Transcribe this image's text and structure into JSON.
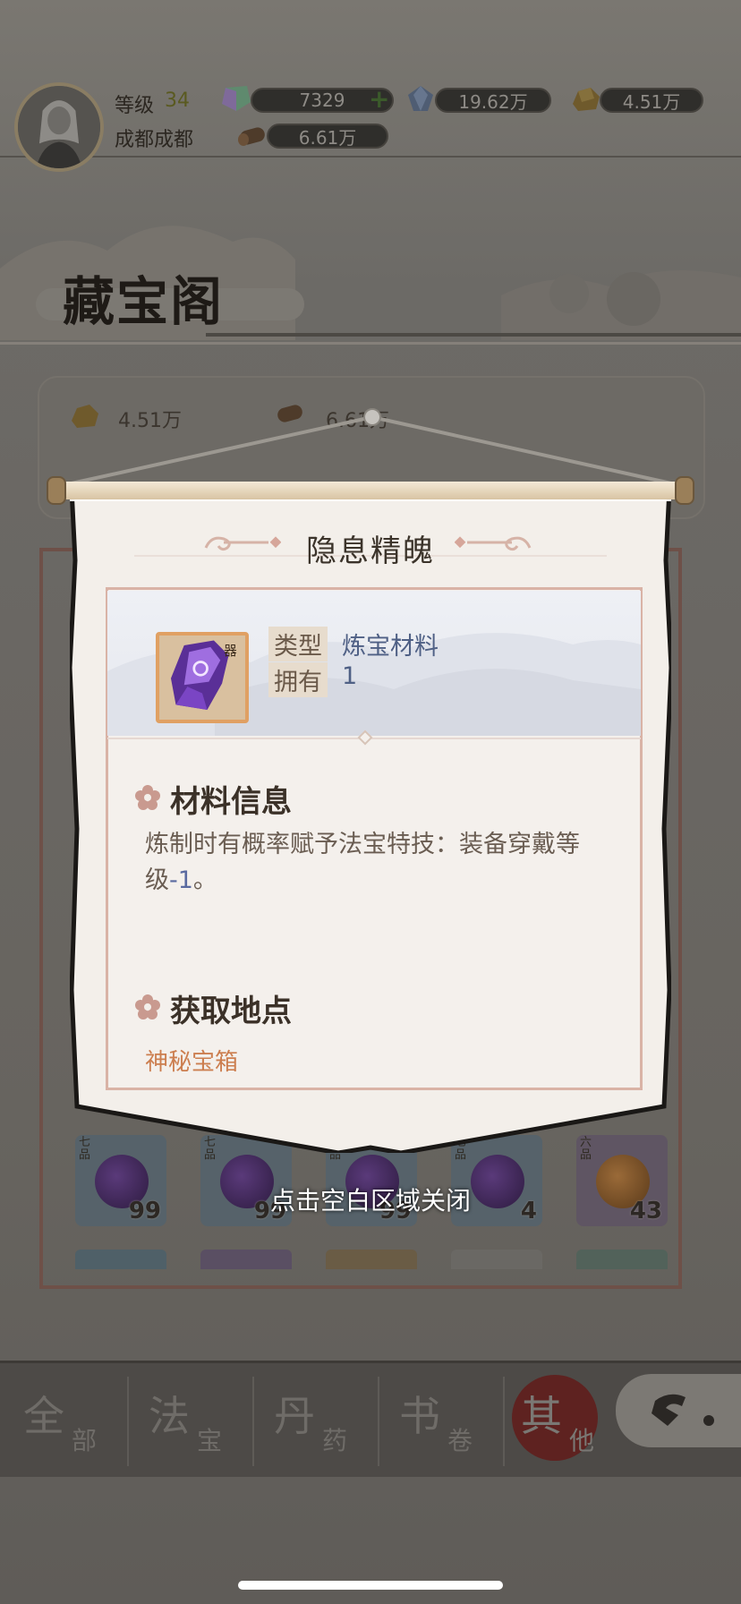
{
  "hud": {
    "level_label": "等级",
    "level_value": "34",
    "player_name": "成都成都",
    "jade_amount": "7329",
    "jade_add": "+",
    "crystal_amount": "19.62万",
    "gold_amount": "4.51万",
    "wood_amount": "6.61万"
  },
  "page": {
    "title": "藏宝阁",
    "panel_gold": "4.51万",
    "panel_wood": "6.61万"
  },
  "inventory_slots": [
    {
      "grade": "七品",
      "count": "99",
      "color": "#7f66a0"
    },
    {
      "grade": "七品",
      "count": "99",
      "color": "#7f66a0"
    },
    {
      "grade": "七品",
      "count": "99",
      "color": "#7f66a0"
    },
    {
      "grade": "七品",
      "count": "4",
      "color": "#7f66a0"
    },
    {
      "grade": "六品",
      "count": "43",
      "color": "#d08a3a"
    }
  ],
  "tabs": [
    {
      "big": "全",
      "small": "部"
    },
    {
      "big": "法",
      "small": "宝"
    },
    {
      "big": "丹",
      "small": "药"
    },
    {
      "big": "书",
      "small": "卷"
    },
    {
      "big": "其",
      "small": "他"
    }
  ],
  "close_hint": "点击空白区域关闭",
  "popup": {
    "item_name": "隐息精魄",
    "type_label": "类型",
    "type_value": "炼宝材料",
    "owned_label": "拥有",
    "owned_value": "1",
    "item_badge": "器",
    "info_heading": "材料信息",
    "description_prefix": "炼制时有概率赋予法宝特技：装备穿戴等级",
    "description_value": "-1",
    "description_suffix": "。",
    "source_heading": "获取地点",
    "source_item": "神秘宝箱"
  },
  "colors": {
    "accent_purple": "#8b5fd6",
    "active_tab": "#b03030",
    "link_orange": "#cc7e4f"
  }
}
